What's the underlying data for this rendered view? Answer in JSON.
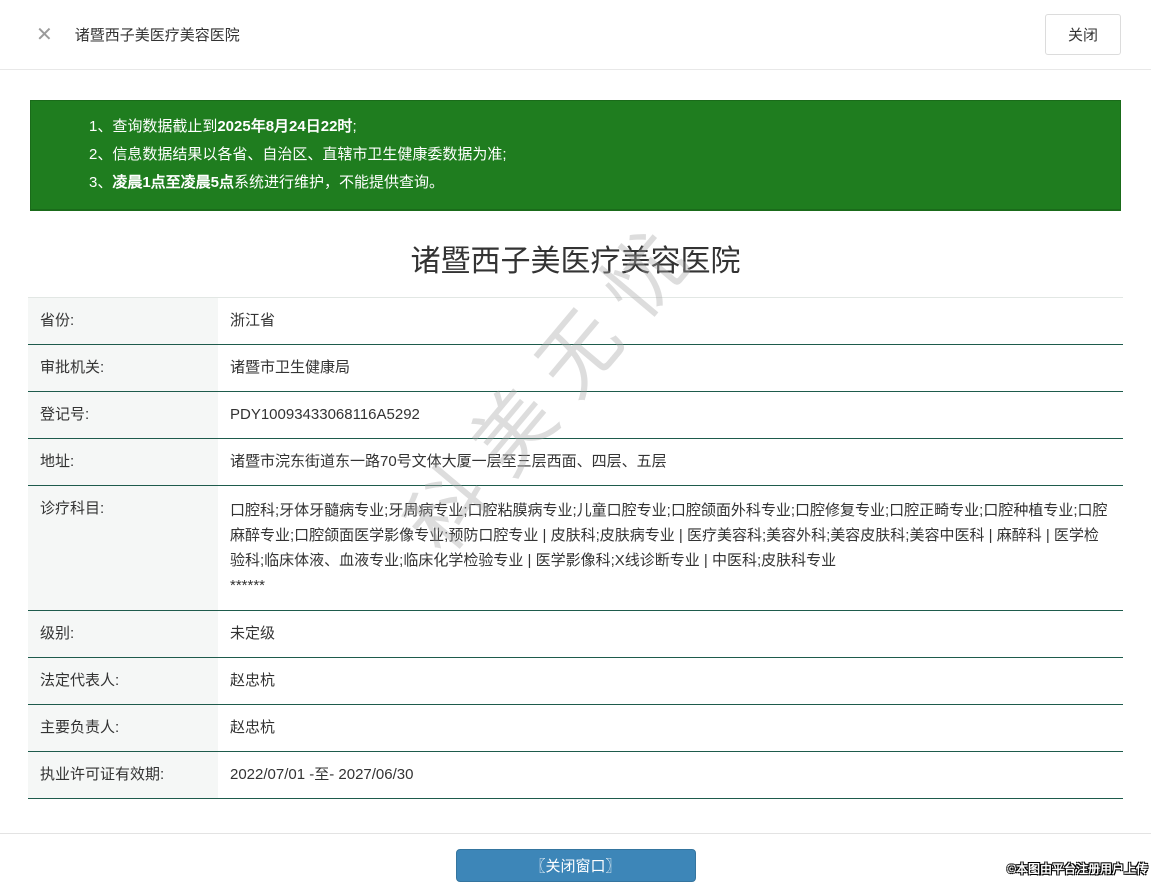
{
  "topbar": {
    "close_icon": "✕",
    "title": "诸暨西子美医疗美容医院",
    "close_button": "关闭"
  },
  "notice": {
    "lines": [
      {
        "prefix": "1、查询数据截止到",
        "bold": "2025年8月24日22时",
        "suffix": ";"
      },
      {
        "prefix": "2、信息数据结果以各省、自治区、直辖市卫生健康委数据为准;",
        "bold": "",
        "suffix": ""
      },
      {
        "prefix": "3、",
        "bold": "凌晨1点至凌晨5点",
        "suffix": "系统进行维护，不能提供查询。"
      }
    ]
  },
  "main": {
    "title": "诸暨西子美医疗美容医院",
    "rows": [
      {
        "label": "省份:",
        "value": "浙江省"
      },
      {
        "label": "审批机关:",
        "value": "诸暨市卫生健康局"
      },
      {
        "label": "登记号:",
        "value": "PDY10093433068116A5292"
      },
      {
        "label": "地址:",
        "value": "诸暨市浣东街道东一路70号文体大厦一层至三层西面、四层、五层"
      },
      {
        "label": "诊疗科目:",
        "value": "口腔科;牙体牙髓病专业;牙周病专业;口腔粘膜病专业;儿童口腔专业;口腔颌面外科专业;口腔修复专业;口腔正畸专业;口腔种植专业;口腔麻醉专业;口腔颌面医学影像专业;预防口腔专业 | 皮肤科;皮肤病专业 | 医疗美容科;美容外科;美容皮肤科;美容中医科 | 麻醉科 | 医学检验科;临床体液、血液专业;临床化学检验专业 | 医学影像科;X线诊断专业 | 中医科;皮肤科专业\n******"
      },
      {
        "label": "级别:",
        "value": "未定级"
      },
      {
        "label": "法定代表人:",
        "value": "赵忠杭"
      },
      {
        "label": "主要负责人:",
        "value": "赵忠杭"
      },
      {
        "label": "执业许可证有效期:",
        "value": "2022/07/01 -至- 2027/06/30"
      }
    ]
  },
  "footer": {
    "close_button": "〖关闭窗口〗"
  },
  "watermark": "科美无忧",
  "copyright": "©本图由平台注册用户上传",
  "colors": {
    "notice_green": "#1f7d1f",
    "row_divider": "#1e5b4c",
    "label_bg": "#f5f7f6",
    "button_blue": "#3d86b8"
  }
}
